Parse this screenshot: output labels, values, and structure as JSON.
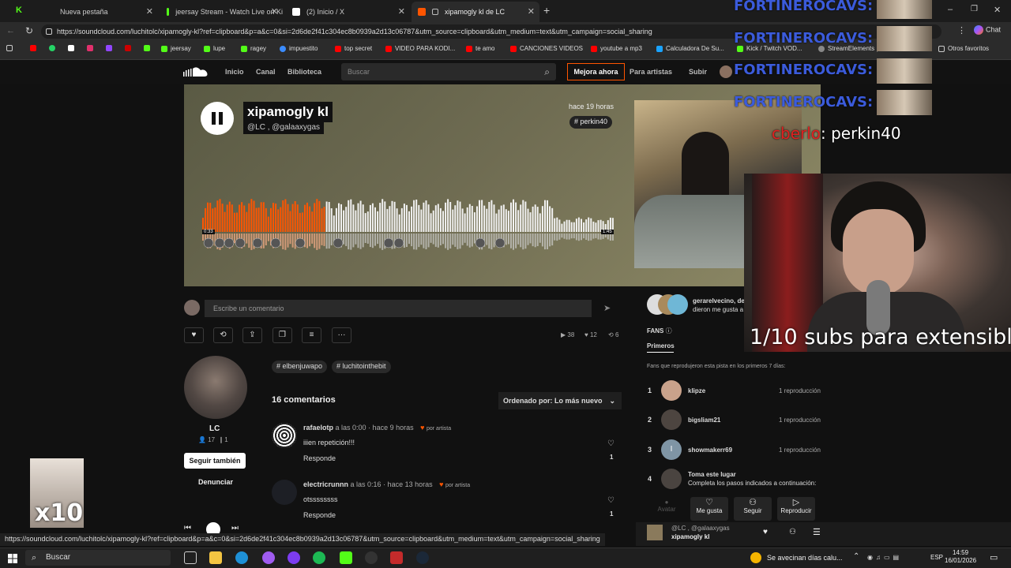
{
  "browser": {
    "tabs": [
      {
        "label": "Nueva pestaña",
        "color": "#53fc18"
      },
      {
        "label": "jeersay Stream - Watch Live on Ki",
        "color": "#53fc18"
      },
      {
        "label": "(2) Inicio / X",
        "color": "#ffffff"
      },
      {
        "label": "xipamogly kl de LC",
        "color": "#ff5500"
      }
    ],
    "url": "https://soundcloud.com/luchitolc/xipamogly-kl?ref=clipboard&p=a&c=0&si=2d6de2f41c304ec8b0939a2d13c06787&utm_source=clipboard&utm_medium=text&utm_campaign=social_sharing",
    "bookmarks": [
      {
        "label": "jeersay",
        "color": "#53fc18"
      },
      {
        "label": "lupe",
        "color": "#53fc18"
      },
      {
        "label": "ragey",
        "color": "#53fc18"
      },
      {
        "label": "impuestito",
        "color": "#3b8cff"
      },
      {
        "label": "top secret",
        "color": "#ff0000"
      },
      {
        "label": "VIDEO PARA KODI...",
        "color": "#ff0000"
      },
      {
        "label": "te amo",
        "color": "#ff0000"
      },
      {
        "label": "CANCIONES VIDEOS",
        "color": "#ff0000"
      },
      {
        "label": "youtube a mp3",
        "color": "#ff0000"
      },
      {
        "label": "Calculadora De Su...",
        "color": "#1aa3ff"
      },
      {
        "label": "Kick / Twitch VOD...",
        "color": "#53fc18"
      },
      {
        "label": "StreamElements |",
        "color": "#888888"
      }
    ],
    "other_bookmarks": "Otros favoritos",
    "chat_label": "Chat"
  },
  "soundcloud": {
    "nav": {
      "home": "Inicio",
      "feed": "Canal",
      "library": "Biblioteca",
      "search_placeholder": "Buscar",
      "upgrade": "Mejora ahora",
      "artists": "Para artistas",
      "upload": "Subir"
    },
    "track": {
      "title": "xipamogly kl",
      "artists": "@LC , @galaaxygas",
      "posted": "hace 19 horas",
      "tag": "# perkin40",
      "time_current": "0:33",
      "time_total": "1:45",
      "progress": 0.3
    },
    "comment_placeholder": "Escribe un comentario",
    "stats": {
      "plays": "38",
      "likes": "12",
      "reposts": "6"
    },
    "uploader": {
      "name": "LC",
      "followers": "17",
      "tracks": "1",
      "follow": "Seguir también",
      "report": "Denunciar"
    },
    "hashtags": [
      "# elbenjuwapo",
      "# luchitointhebit"
    ],
    "comments_count": "16 comentarios",
    "sort_label": "Ordenado por: Lo más nuevo",
    "comments": [
      {
        "user": "rafaelotp",
        "at": " a las ",
        "time": "0:00",
        "ago": " · hace 9 horas",
        "by_artist": "por artista",
        "text": "iiien repetición!!!",
        "reply": "Responde",
        "likes": "1"
      },
      {
        "user": "electricrunnn",
        "at": " a las ",
        "time": "0:16",
        "ago": " · hace 13 horas",
        "by_artist": "por artista",
        "text": "otssssssss",
        "reply": "Responde",
        "likes": "1"
      }
    ],
    "likes_panel": {
      "names": "gerarelvecino, de",
      "text": "dieron me gusta a"
    },
    "fans": {
      "header": "FANS",
      "tab": "Primeros",
      "subtitle": "Fans que reprodujeron esta pista en los primeros 7 días:",
      "list": [
        {
          "rank": "1",
          "name": "klipze",
          "plays": "1 reproducción"
        },
        {
          "rank": "2",
          "name": "bigsliam21",
          "plays": "1 reproducción"
        },
        {
          "rank": "3",
          "name": "showmakerr69",
          "plays": "1 reproducción",
          "initial": "I"
        },
        {
          "rank": "4",
          "name": "Toma este lugar",
          "plays": "Completa los pasos indicados a continuación:"
        }
      ],
      "actions": {
        "avatar": "Avatar",
        "like": "Me gusta",
        "follow": "Seguir",
        "play": "Reproducir"
      }
    },
    "player": {
      "artists": "@LC , @galaaxygas",
      "title": "xipamogly kl"
    }
  },
  "overlay": {
    "names": [
      "FORTINEROCAVS:",
      "FORTINEROCAVS:",
      "FORTINEROCAVS:",
      "FORTINEROCAVS:"
    ],
    "chat_user": "cberlo",
    "chat_text": ": perkin40",
    "subs_text": "1/10 subs para extensible",
    "badge": "x10"
  },
  "status_url": "https://soundcloud.com/luchitolc/xipamogly-kl?ref=clipboard&p=a&c=0&si=2d6de2f41c304ec8b0939a2d13c06787&utm_source=clipboard&utm_medium=text&utm_campaign=social_sharing",
  "taskbar": {
    "search": "Buscar",
    "notification": "Se avecinan días calu...",
    "lang": "ESP",
    "time": "14:59",
    "date": "16/01/2026"
  }
}
